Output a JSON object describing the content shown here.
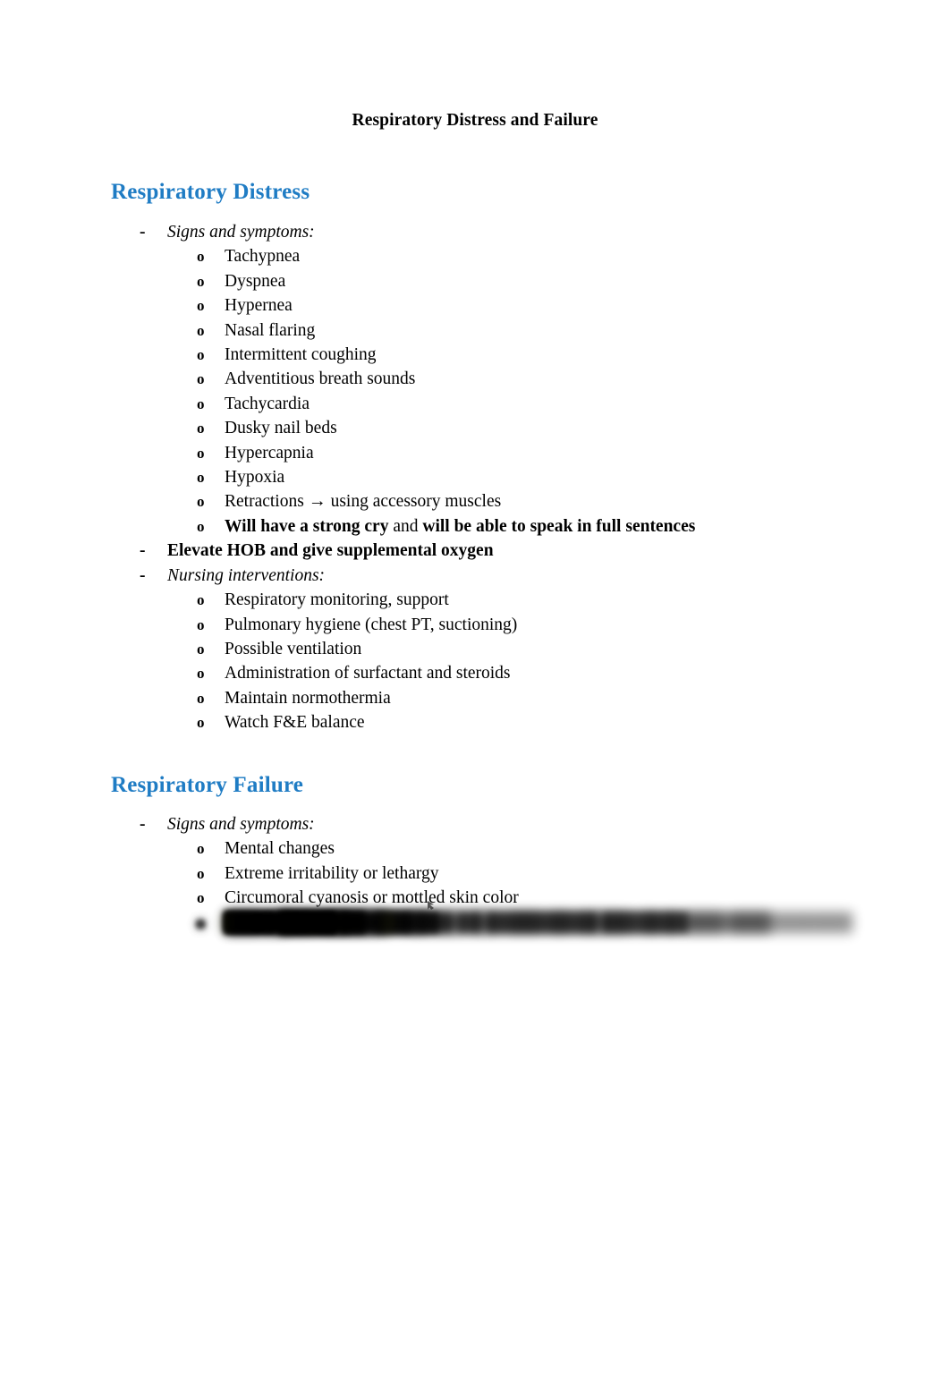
{
  "document": {
    "title": "Respiratory Distress and Failure"
  },
  "sections": [
    {
      "heading": "Respiratory Distress",
      "blocks": [
        {
          "level1": "Signs and symptoms:",
          "style": "italic",
          "children": [
            "Tachypnea",
            "Dyspnea",
            "Hypernea",
            "Nasal flaring",
            "Intermittent coughing",
            "Adventitious breath sounds",
            "Tachycardia",
            "Dusky nail beds",
            "Hypercapnia",
            "Hypoxia"
          ],
          "retractions": {
            "label": "Retractions",
            "arrow": "→",
            "tail": "using accessory muscles"
          },
          "strong_cry": {
            "part1": "Will have a strong cry",
            "part2": "and",
            "part3": "will be able to speak in full sentences"
          }
        },
        {
          "level1": "Elevate HOB and give supplemental oxygen",
          "style": "bold",
          "children": []
        },
        {
          "level1": "Nursing interventions:",
          "style": "italic",
          "children": [
            "Respiratory monitoring, support",
            "Pulmonary hygiene (chest PT, suctioning)",
            "Possible ventilation",
            "Administration of surfactant and steroids",
            "Maintain normothermia",
            "Watch F&E balance"
          ]
        }
      ]
    },
    {
      "heading": "Respiratory Failure",
      "blocks": [
        {
          "level1": "Signs and symptoms:",
          "style": "italic",
          "children": [
            "Mental changes",
            "Extreme irritability or lethargy",
            "Circumoral cyanosis or mottled skin color"
          ]
        }
      ]
    }
  ],
  "obscured": {
    "note": "Lower portion of the page is blurred and illegible",
    "lines": [
      {
        "level": 2,
        "marker": "o",
        "text": "█████████",
        "bold": true
      },
      {
        "level": 2,
        "marker": "o",
        "text": "████ ███████",
        "bold": true
      },
      {
        "level": 2,
        "marker": "o",
        "text": "█████████ ████████",
        "bold": false
      },
      {
        "level": 2,
        "marker": "o",
        "text": "██████████  →  ███ ███ ██ █████████ ███████",
        "bold": true
      },
      {
        "level": 3,
        "marker": "▪",
        "text": "███████████",
        "bold": false
      },
      {
        "level": 3,
        "marker": "▪",
        "text": "███████",
        "bold": false
      },
      {
        "level": 3,
        "marker": "▪",
        "text": "████████████",
        "bold": false
      },
      {
        "level": 2,
        "marker": "o",
        "text": "█████████████",
        "highlight": true,
        "tail": " →  ████ ██████ ██ █████ ███ ███████",
        "bold": true
      },
      {
        "level": 2,
        "marker": "o",
        "text": "███ ████ ██████ ██ ██████ ██████████ ██ █████ ██████████",
        "bold": false
      },
      {
        "level": 2,
        "marker": "o",
        "text": "█████",
        "bold": true
      }
    ]
  },
  "colors": {
    "heading_blue": "#1f7cc4",
    "highlight_yellow": "#ccd02a",
    "text_black": "#000000"
  }
}
